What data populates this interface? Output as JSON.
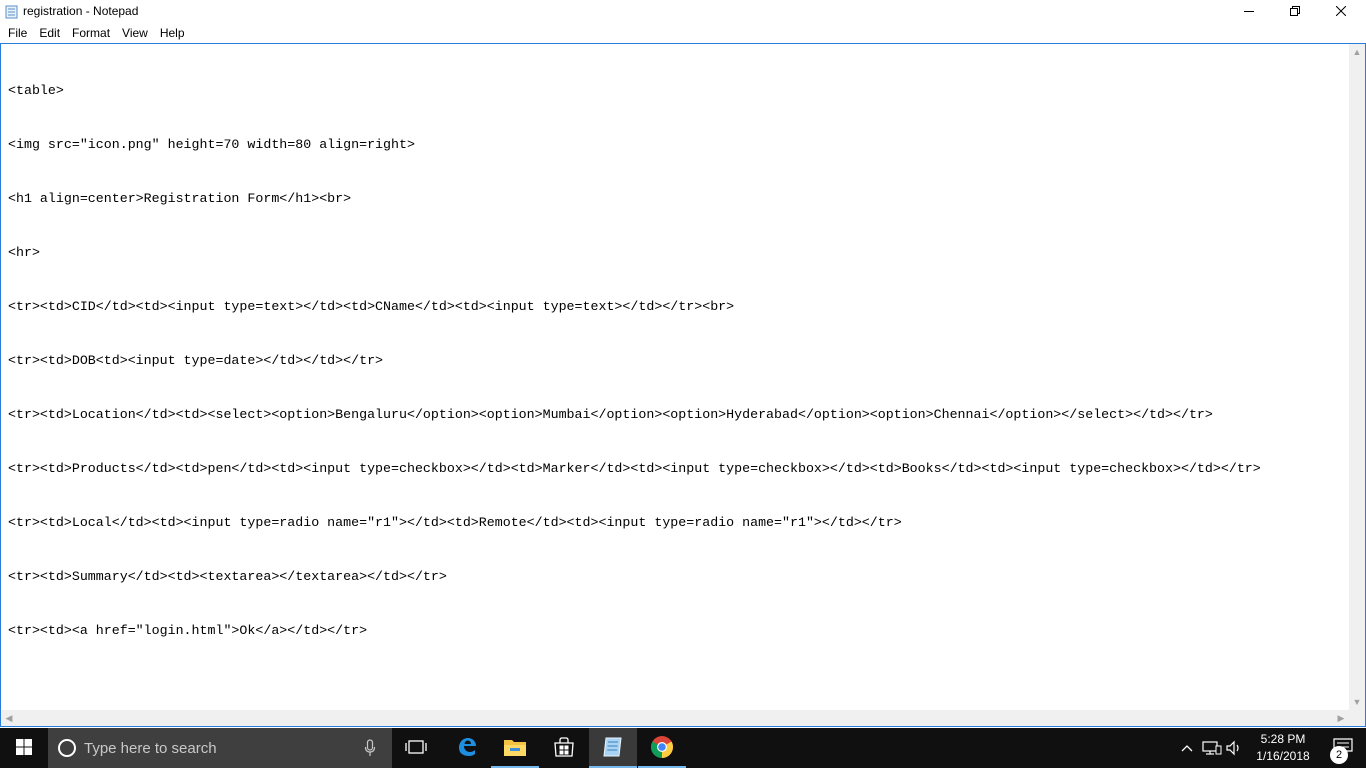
{
  "window": {
    "title": "registration - Notepad"
  },
  "menu": {
    "items": [
      "File",
      "Edit",
      "Format",
      "View",
      "Help"
    ]
  },
  "editor": {
    "lines": [
      "<table>",
      "<img src=\"icon.png\" height=70 width=80 align=right>",
      "<h1 align=center>Registration Form</h1><br>",
      "<hr>",
      "<tr><td>CID</td><td><input type=text></td><td>CName</td><td><input type=text></td></tr><br>",
      "<tr><td>DOB<td><input type=date></td></td></tr>",
      "<tr><td>Location</td><td><select><option>Bengaluru</option><option>Mumbai</option><option>Hyderabad</option><option>Chennai</option></select></td></tr>",
      "<tr><td>Products</td><td>pen</td><td><input type=checkbox></td><td>Marker</td><td><input type=checkbox></td><td>Books</td><td><input type=checkbox></td></tr>",
      "<tr><td>Local</td><td><input type=radio name=\"r1\"></td><td>Remote</td><td><input type=radio name=\"r1\"></td></tr>",
      "<tr><td>Summary</td><td><textarea></textarea></td></tr>",
      "<tr><td><a href=\"login.html\">Ok</a></td></tr>"
    ]
  },
  "taskbar": {
    "search_placeholder": "Type here to search",
    "apps": [
      "task-view",
      "edge",
      "file-explorer",
      "store",
      "notepad",
      "chrome"
    ],
    "clock_time": "5:28 PM",
    "clock_date": "1/16/2018",
    "notification_count": "2"
  },
  "colors": {
    "accent": "#2b7bd9",
    "taskbar_bg": "#101010",
    "search_bg": "#3f3f3f",
    "active_underline": "#76b9ed"
  }
}
